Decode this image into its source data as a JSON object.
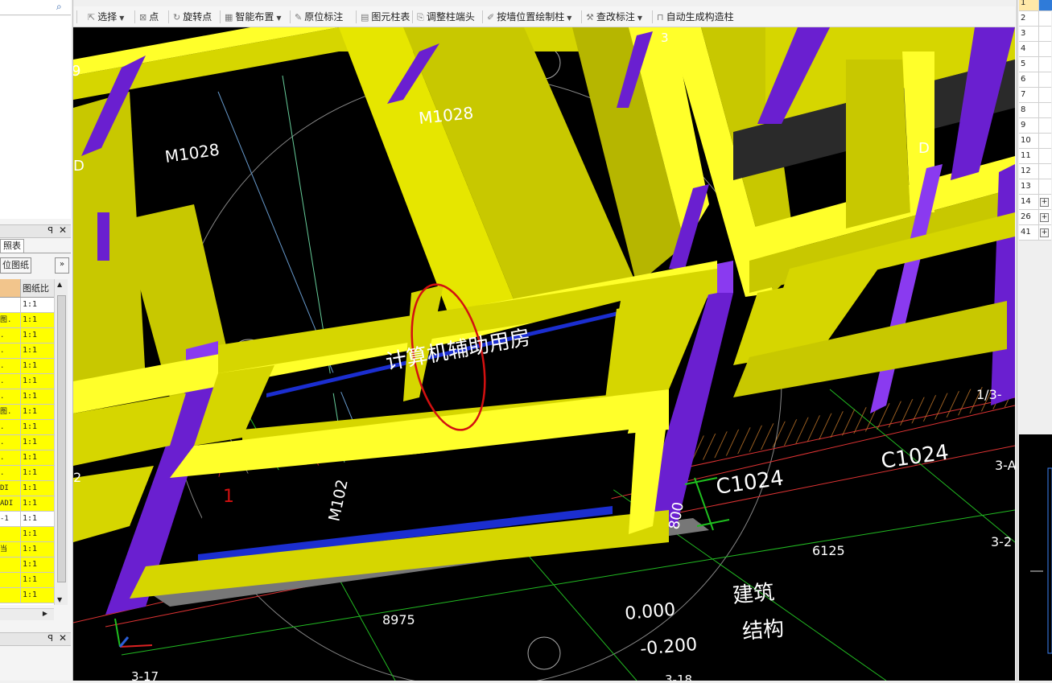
{
  "toolbar": {
    "items": [
      {
        "label": "选择",
        "icon": "pointer-icon",
        "dropdown": true
      },
      {
        "label": "点",
        "icon": "point-icon",
        "dropdown": false
      },
      {
        "label": "旋转点",
        "icon": "rotate-point-icon",
        "dropdown": false
      },
      {
        "label": "智能布置",
        "icon": "smart-layout-icon",
        "dropdown": true
      },
      {
        "label": "原位标注",
        "icon": "in-place-label-icon",
        "dropdown": false
      },
      {
        "label": "图元柱表",
        "icon": "column-table-icon",
        "dropdown": false
      },
      {
        "label": "调整柱端头",
        "icon": "adjust-column-end-icon",
        "dropdown": false
      },
      {
        "label": "按墙位置绘制柱",
        "icon": "draw-column-by-wall-icon",
        "dropdown": true
      },
      {
        "label": "查改标注",
        "icon": "check-label-icon",
        "dropdown": true
      },
      {
        "label": "自动生成构造柱",
        "icon": "auto-generate-column-icon",
        "dropdown": false
      }
    ]
  },
  "left_panel": {
    "tab_label": "照表",
    "locate_button": "位图纸",
    "more_button": "»",
    "grid_header": "图纸比",
    "rows": [
      {
        "name": "",
        "scale": "1:1",
        "color": "white"
      },
      {
        "name": "图.",
        "scale": "1:1",
        "color": "yellow"
      },
      {
        "name": ".",
        "scale": "1:1",
        "color": "yellow"
      },
      {
        "name": ".",
        "scale": "1:1",
        "color": "yellow"
      },
      {
        "name": ".",
        "scale": "1:1",
        "color": "yellow"
      },
      {
        "name": ".",
        "scale": "1:1",
        "color": "yellow"
      },
      {
        "name": ".",
        "scale": "1:1",
        "color": "yellow"
      },
      {
        "name": "图.",
        "scale": "1:1",
        "color": "yellow"
      },
      {
        "name": ".",
        "scale": "1:1",
        "color": "yellow"
      },
      {
        "name": ".",
        "scale": "1:1",
        "color": "yellow"
      },
      {
        "name": ".",
        "scale": "1:1",
        "color": "yellow"
      },
      {
        "name": ".",
        "scale": "1:1",
        "color": "yellow"
      },
      {
        "name": "DI",
        "scale": "1:1",
        "color": "yellow"
      },
      {
        "name": "ADI",
        "scale": "1:1",
        "color": "yellow"
      },
      {
        "name": "-1",
        "scale": "1:1",
        "color": "white"
      },
      {
        "name": "",
        "scale": "1:1",
        "color": "yellow"
      },
      {
        "name": "当",
        "scale": "1:1",
        "color": "yellow"
      },
      {
        "name": "",
        "scale": "1:1",
        "color": "yellow"
      },
      {
        "name": "",
        "scale": "1:1",
        "color": "yellow"
      },
      {
        "name": "",
        "scale": "1:1",
        "color": "yellow"
      }
    ]
  },
  "right_panel": {
    "rows": [
      {
        "n": "1",
        "selected": true,
        "expand": false
      },
      {
        "n": "2",
        "selected": false,
        "expand": false
      },
      {
        "n": "3",
        "selected": false,
        "expand": false
      },
      {
        "n": "4",
        "selected": false,
        "expand": false
      },
      {
        "n": "5",
        "selected": false,
        "expand": false
      },
      {
        "n": "6",
        "selected": false,
        "expand": false
      },
      {
        "n": "7",
        "selected": false,
        "expand": false
      },
      {
        "n": "8",
        "selected": false,
        "expand": false
      },
      {
        "n": "9",
        "selected": false,
        "expand": false
      },
      {
        "n": "10",
        "selected": false,
        "expand": false
      },
      {
        "n": "11",
        "selected": false,
        "expand": false
      },
      {
        "n": "12",
        "selected": false,
        "expand": false
      },
      {
        "n": "13",
        "selected": false,
        "expand": false
      },
      {
        "n": "14",
        "selected": false,
        "expand": true
      },
      {
        "n": "26",
        "selected": false,
        "expand": true
      },
      {
        "n": "41",
        "selected": false,
        "expand": true
      }
    ]
  },
  "viewport": {
    "labels": {
      "door_a": "M1028",
      "door_b": "M1028",
      "door_c": "M102",
      "room_name": "计算机辅助用房",
      "window_a": "C1024",
      "window_b": "C1024",
      "dim_800": "800",
      "dim_6125": "6125",
      "dim_8975": "8975",
      "elev_0": "0.000",
      "elev_neg": "-0.200",
      "tag_arch": "建筑",
      "tag_struct": "结构",
      "axis_1_3a": "1/3-",
      "axis_3a": "3-A",
      "axis_32": "3-2",
      "axis_317": "3-17",
      "axis_318": "3-18",
      "axis_3": "3",
      "axis_9": "9",
      "axis_d": "D",
      "axis_d2": "D",
      "axis_2": "2",
      "axis_1": "1"
    },
    "colors": {
      "wall_yellow": "#d6d600",
      "wall_yellow_light": "#ffff2a",
      "column_purple": "#6a1fd0",
      "column_purple_light": "#8a3af0",
      "highlight_ring": "#d31010",
      "cad_green": "#1fbf1f"
    }
  }
}
